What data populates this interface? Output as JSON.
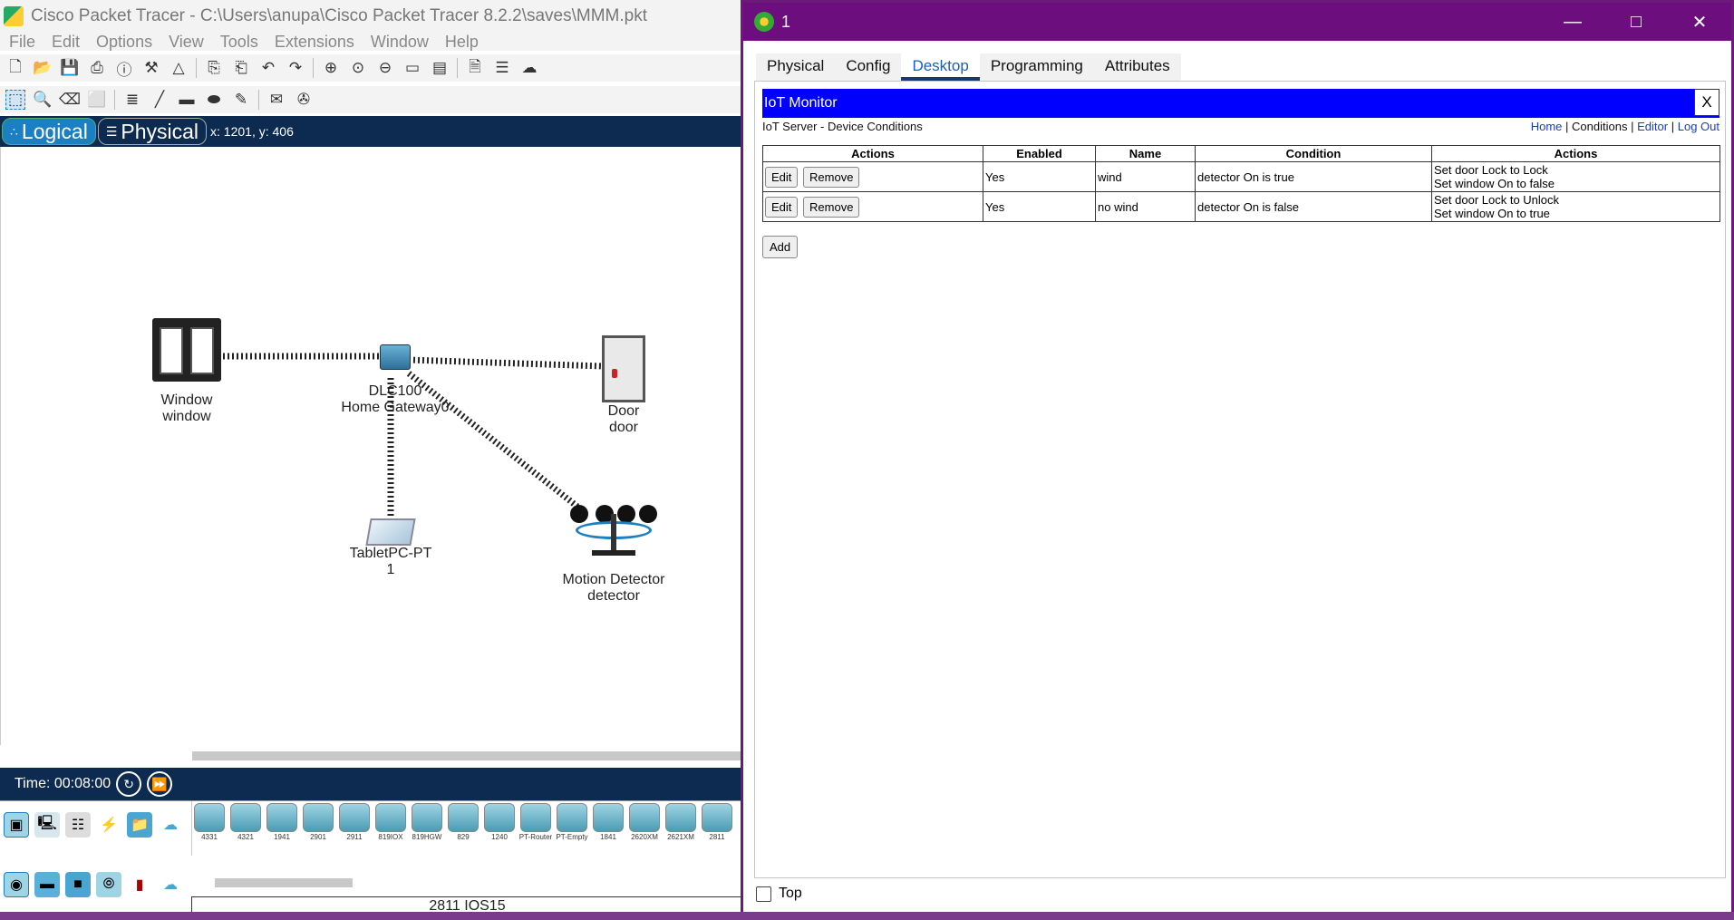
{
  "main_window": {
    "title": "Cisco Packet Tracer - C:\\Users\\anupa\\Cisco Packet Tracer 8.2.2\\saves\\MMM.pkt",
    "menu": [
      "File",
      "Edit",
      "Options",
      "View",
      "Tools",
      "Extensions",
      "Window",
      "Help"
    ],
    "mode_logical": "Logical",
    "mode_physical": "Physical",
    "coordinates": "x: 1201, y: 406",
    "time": "Time: 00:08:00",
    "status_model": "2811 IOS15",
    "devices": [
      "4331",
      "4321",
      "1941",
      "2901",
      "2911",
      "819IOX",
      "819HGW",
      "829",
      "1240",
      "PT-Router",
      "PT-Empty",
      "1841",
      "2620XM",
      "2621XM",
      "2811"
    ]
  },
  "topology": {
    "window_label_1": "Window",
    "window_label_2": "window",
    "gateway_label_1": "DLC100",
    "gateway_label_2": "Home Gateway0",
    "door_label_1": "Door",
    "door_label_2": "door",
    "tablet_label_1": "TabletPC-PT",
    "tablet_label_2": "1",
    "detector_label_1": "Motion Detector",
    "detector_label_2": "detector"
  },
  "iot_window": {
    "title": "1",
    "tabs": [
      "Physical",
      "Config",
      "Desktop",
      "Programming",
      "Attributes"
    ],
    "active_tab": "Desktop",
    "header": "IoT Monitor",
    "close_label": "X",
    "subheader": "IoT Server - Device Conditions",
    "links": {
      "home": "Home",
      "conditions": "Conditions",
      "editor": "Editor",
      "logout": "Log Out",
      "sep": "|"
    },
    "columns": [
      "Actions",
      "Enabled",
      "Name",
      "Condition",
      "Actions"
    ],
    "edit_label": "Edit",
    "remove_label": "Remove",
    "rows": [
      {
        "enabled": "Yes",
        "name": "wind",
        "condition": "detector On is true",
        "action_1": "Set door Lock to Lock",
        "action_2": "Set window On to false"
      },
      {
        "enabled": "Yes",
        "name": "no wind",
        "condition": "detector On is false",
        "action_1": "Set door Lock to Unlock",
        "action_2": "Set window On to true"
      }
    ],
    "add_label": "Add",
    "top_label": "Top"
  },
  "colors": {
    "title_purple": "#6d0e7e",
    "iot_header_blue": "#0000ff",
    "nav_navy": "#0d2b50",
    "active_mode": "#1b7fc4"
  }
}
